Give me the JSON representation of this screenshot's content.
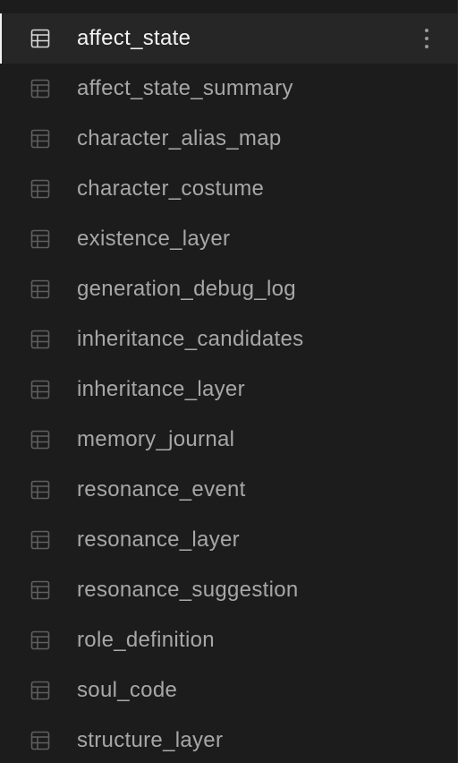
{
  "sidebar": {
    "active_index": 0,
    "colors": {
      "background": "#1c1c1c",
      "active_background": "#262626",
      "active_text": "#f2f2f2",
      "text": "#a7a7a7",
      "icon_active": "#d9d9d9",
      "icon": "#5f5f5f"
    },
    "item_icon": "table-icon",
    "more_icon": "kebab-menu-icon",
    "items": [
      {
        "label": "affect_state"
      },
      {
        "label": "affect_state_summary"
      },
      {
        "label": "character_alias_map"
      },
      {
        "label": "character_costume"
      },
      {
        "label": "existence_layer"
      },
      {
        "label": "generation_debug_log"
      },
      {
        "label": "inheritance_candidates"
      },
      {
        "label": "inheritance_layer"
      },
      {
        "label": "memory_journal"
      },
      {
        "label": "resonance_event"
      },
      {
        "label": "resonance_layer"
      },
      {
        "label": "resonance_suggestion"
      },
      {
        "label": "role_definition"
      },
      {
        "label": "soul_code"
      },
      {
        "label": "structure_layer"
      }
    ]
  }
}
